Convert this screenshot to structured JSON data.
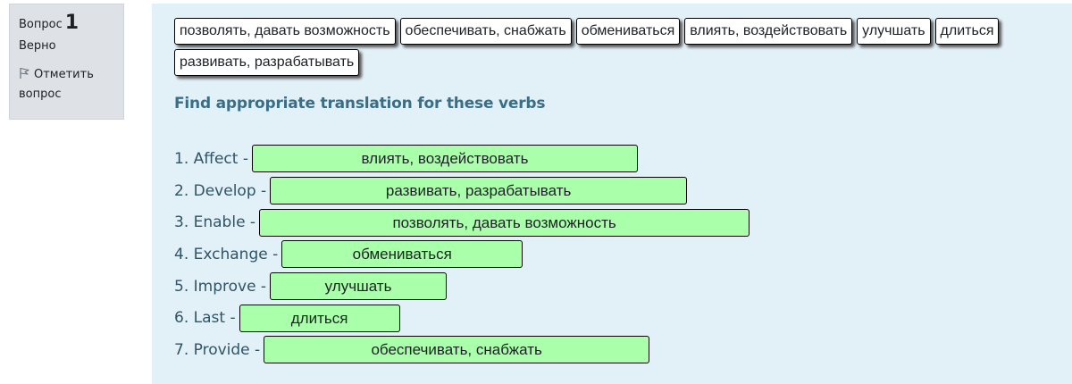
{
  "info": {
    "question_label": "Вопрос",
    "question_number": "1",
    "state": "Верно",
    "flag_label": "Отметить вопрос"
  },
  "choices": [
    "позволять, давать возможность",
    "обеспечивать, снабжать",
    "обмениваться",
    "влиять, воздействовать",
    "улучшать",
    "длиться",
    "развивать, разрабатывать"
  ],
  "prompt": "Find appropriate translation for these verbs",
  "rows": [
    {
      "label": "1. Affect -",
      "answer": "влиять, воздействовать"
    },
    {
      "label": "2. Develop -",
      "answer": "развивать, разрабатывать"
    },
    {
      "label": "3. Enable -",
      "answer": "позволять, давать возможность"
    },
    {
      "label": "4. Exchange -",
      "answer": "обмениваться"
    },
    {
      "label": "5. Improve -",
      "answer": "улучшать"
    },
    {
      "label": "6. Last -",
      "answer": "длиться"
    },
    {
      "label": "7. Provide -",
      "answer": "обеспечивать, снабжать"
    }
  ],
  "colors": {
    "correct_drop": "#aaffaa",
    "content_bg": "#e2f1f8",
    "prompt_text": "#3a6e86"
  }
}
